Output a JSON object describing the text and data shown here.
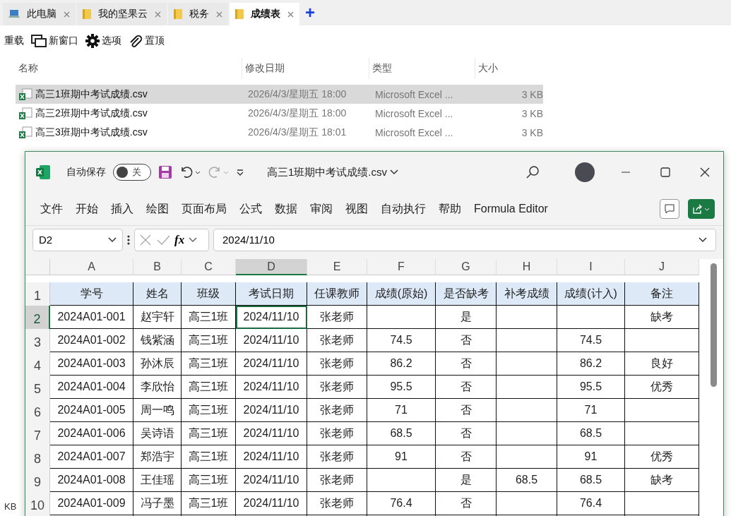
{
  "explorer": {
    "tabs": [
      {
        "label": "此电脑",
        "kind": "computer",
        "selected": false
      },
      {
        "label": "我的坚果云",
        "kind": "folder",
        "selected": false
      },
      {
        "label": "税务",
        "kind": "folder",
        "selected": false
      },
      {
        "label": "成绩表",
        "kind": "folder",
        "selected": true
      }
    ],
    "new_tab": "+",
    "toolbar": [
      {
        "label": "重载",
        "kind": "none"
      },
      {
        "label": "新窗口",
        "kind": "window"
      },
      {
        "label": "选项",
        "kind": "gear"
      },
      {
        "label": "置顶",
        "kind": "clip"
      }
    ],
    "columns": [
      "名称",
      "修改日期",
      "类型",
      "大小"
    ],
    "files": [
      {
        "name": "高三1班期中考试成绩.csv",
        "modified": "2026/4/3/星期五 18:00",
        "type": "Microsoft Excel ...",
        "size": "3 KB",
        "selected": true
      },
      {
        "name": "高三2班期中考试成绩.csv",
        "modified": "2026/4/3/星期五 18:00",
        "type": "Microsoft Excel ...",
        "size": "3 KB",
        "selected": false
      },
      {
        "name": "高三3班期中考试成绩.csv",
        "modified": "2026/4/3/星期五 18:01",
        "type": "Microsoft Excel ...",
        "size": "3 KB",
        "selected": false
      }
    ],
    "status": "KB"
  },
  "excel": {
    "autosave_label": "自动保存",
    "autosave": {
      "label": "关",
      "on": false
    },
    "title": "高三1班期中考试成绩.csv",
    "ribbon_tabs": [
      "文件",
      "开始",
      "插入",
      "绘图",
      "页面布局",
      "公式",
      "数据",
      "审阅",
      "视图",
      "自动执行",
      "帮助",
      "Formula Editor"
    ],
    "name_box": "D2",
    "fx_symbol": "fx",
    "formula": "2024/11/10",
    "column_letters": [
      {
        "label": "A",
        "selected": false
      },
      {
        "label": "B",
        "selected": false
      },
      {
        "label": "C",
        "selected": false
      },
      {
        "label": "D",
        "selected": true
      },
      {
        "label": "E",
        "selected": false
      },
      {
        "label": "F",
        "selected": false
      },
      {
        "label": "G",
        "selected": false
      },
      {
        "label": "H",
        "selected": false
      },
      {
        "label": "I",
        "selected": false
      },
      {
        "label": "J",
        "selected": false
      }
    ],
    "rows": [
      {
        "number": "1",
        "selected": false,
        "cells": [
          "学号",
          "姓名",
          "班级",
          "考试日期",
          "任课教师",
          "成绩(原始)",
          "是否缺考",
          "补考成绩",
          "成绩(计入)",
          "备注"
        ]
      },
      {
        "number": "2",
        "selected": true,
        "cells": [
          "2024A01-001",
          "赵宇轩",
          "高三1班",
          "2024/11/10",
          "张老师",
          null,
          "是",
          null,
          null,
          "缺考"
        ]
      },
      {
        "number": "3",
        "selected": false,
        "cells": [
          "2024A01-002",
          "钱紫涵",
          "高三1班",
          "2024/11/10",
          "张老师",
          "74.5",
          "否",
          null,
          "74.5",
          null
        ]
      },
      {
        "number": "4",
        "selected": false,
        "cells": [
          "2024A01-003",
          "孙沐辰",
          "高三1班",
          "2024/11/10",
          "张老师",
          "86.2",
          "否",
          null,
          "86.2",
          "良好"
        ]
      },
      {
        "number": "5",
        "selected": false,
        "cells": [
          "2024A01-004",
          "李欣怡",
          "高三1班",
          "2024/11/10",
          "张老师",
          "95.5",
          "否",
          null,
          "95.5",
          "优秀"
        ]
      },
      {
        "number": "6",
        "selected": false,
        "cells": [
          "2024A01-005",
          "周一鸣",
          "高三1班",
          "2024/11/10",
          "张老师",
          "71",
          "否",
          null,
          "71",
          null
        ]
      },
      {
        "number": "7",
        "selected": false,
        "cells": [
          "2024A01-006",
          "吴诗语",
          "高三1班",
          "2024/11/10",
          "张老师",
          "68.5",
          "否",
          null,
          "68.5",
          null
        ]
      },
      {
        "number": "8",
        "selected": false,
        "cells": [
          "2024A01-007",
          "郑浩宇",
          "高三1班",
          "2024/11/10",
          "张老师",
          "91",
          "否",
          null,
          "91",
          "优秀"
        ]
      },
      {
        "number": "9",
        "selected": false,
        "cells": [
          "2024A01-008",
          "王佳瑶",
          "高三1班",
          "2024/11/10",
          "张老师",
          null,
          "是",
          "68.5",
          "68.5",
          "缺考"
        ]
      },
      {
        "number": "10",
        "selected": false,
        "cells": [
          "2024A01-009",
          "冯子墨",
          "高三1班",
          "2024/11/10",
          "张老师",
          "76.4",
          "否",
          null,
          "76.4",
          null
        ]
      }
    ]
  }
}
